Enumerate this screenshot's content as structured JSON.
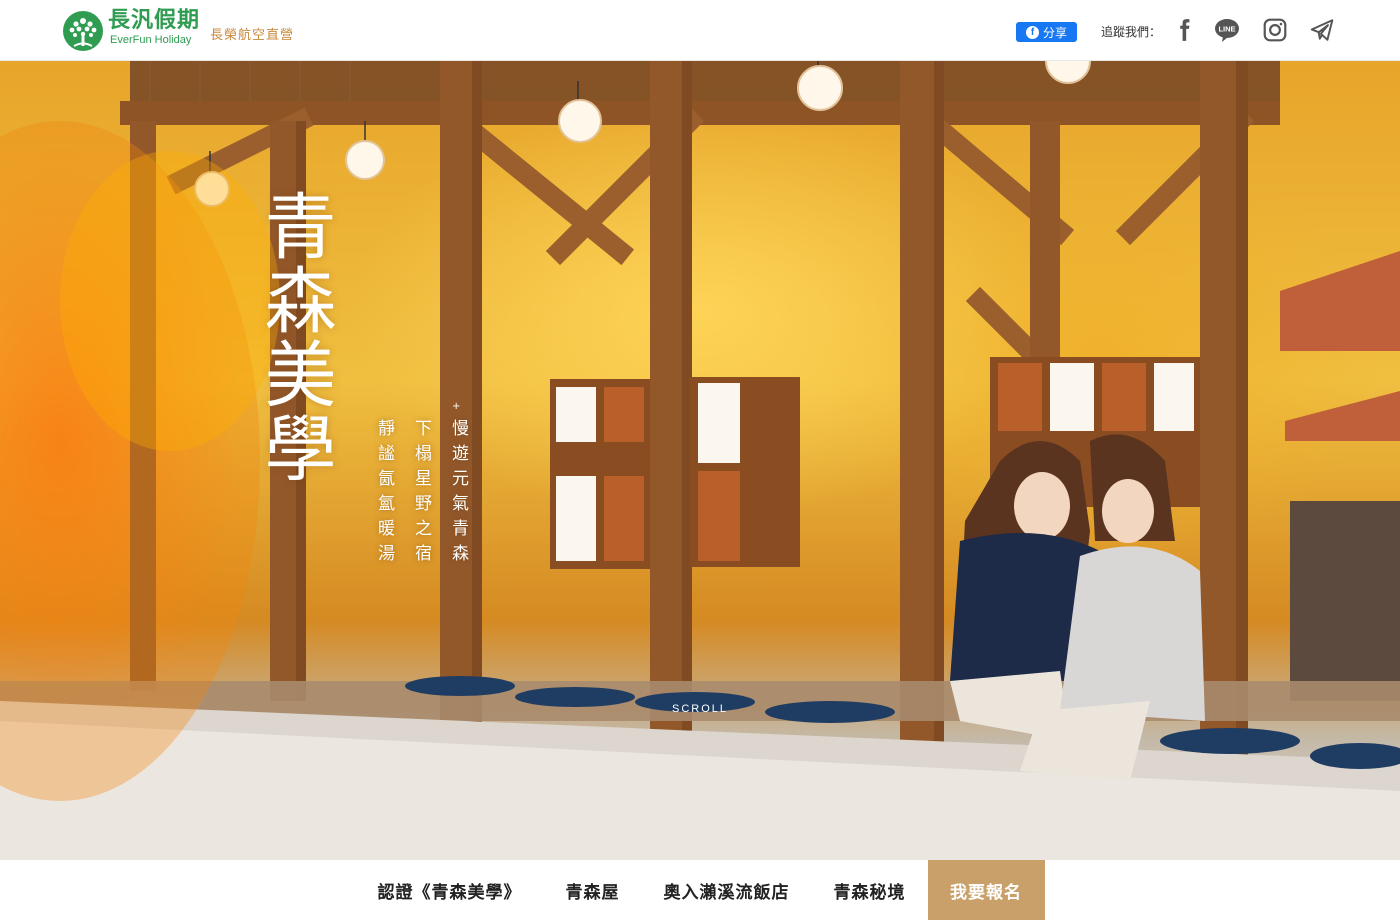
{
  "header": {
    "brand_cn": "長汎假期",
    "brand_en": "EverFun Holiday",
    "brand_sub": "長榮航空直營",
    "share_label": "分享",
    "follow_label": "追蹤我們：",
    "social": [
      {
        "name": "facebook-icon"
      },
      {
        "name": "line-icon",
        "text": "LINE"
      },
      {
        "name": "instagram-icon"
      },
      {
        "name": "telegram-icon"
      }
    ]
  },
  "hero": {
    "title": "青森美學",
    "lines": [
      "慢遊元氣青森",
      "下榻星野之宿",
      "靜謐氤氳暖湯"
    ],
    "scroll_label": "SCROLL"
  },
  "nav": {
    "items": [
      "認證《青森美學》",
      "青森屋",
      "奧入瀨溪流飯店",
      "青森秘境"
    ],
    "cta": "我要報名"
  },
  "colors": {
    "brand_green": "#2f9c52",
    "brand_gold": "#c8893a",
    "cta_bg": "#c9a06a",
    "facebook_blue": "#1877f2"
  }
}
